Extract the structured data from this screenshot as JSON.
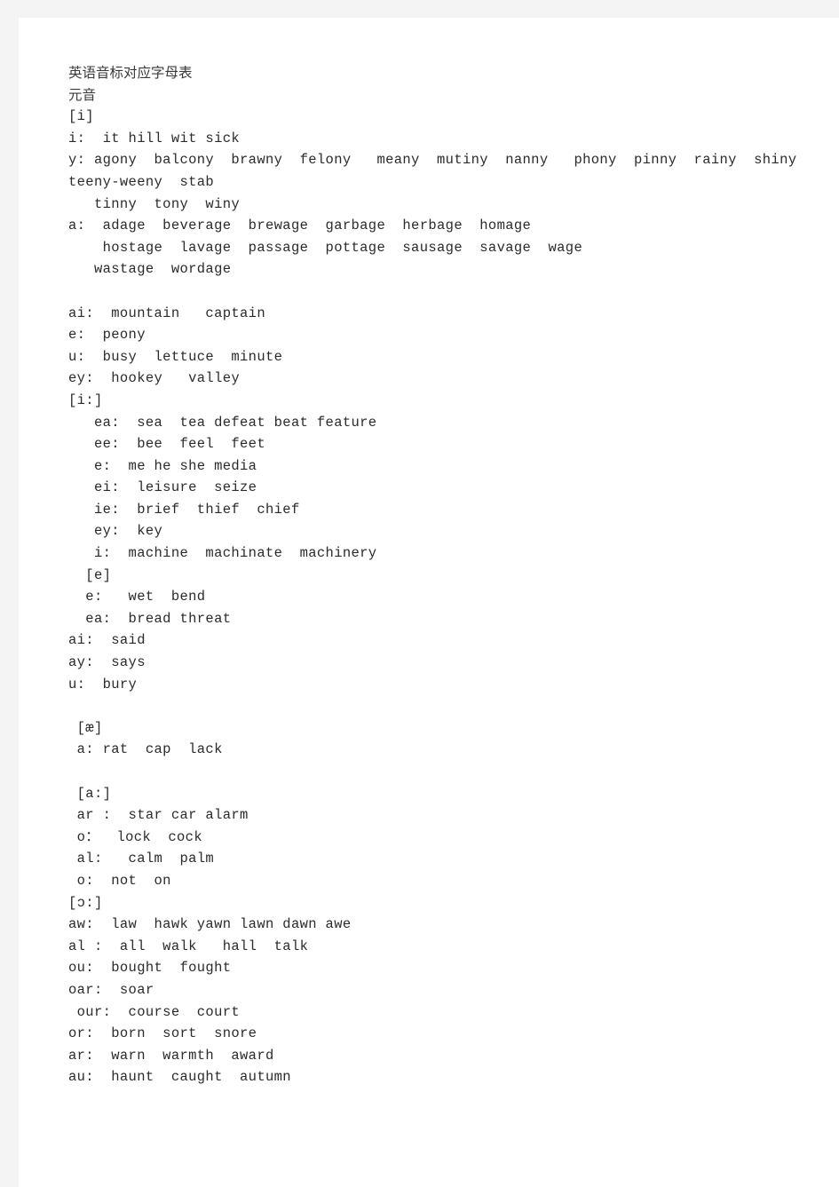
{
  "document": {
    "title_cn": "英语音标对应字母表",
    "section_heading_cn": "元音",
    "lines": [
      {
        "id": "title",
        "kind": "title",
        "text": "英语音标对应字母表"
      },
      {
        "id": "vowels-heading",
        "kind": "title",
        "text": "元音"
      },
      {
        "id": "sym-i",
        "kind": "symbol",
        "text": "[i]"
      },
      {
        "id": "i-i",
        "kind": "entry",
        "text": "i:  it hill wit sick"
      },
      {
        "id": "i-y-1",
        "kind": "entry",
        "text": "y: agony  balcony  brawny  felony   meany  mutiny  nanny   phony  pinny  rainy  shiny"
      },
      {
        "id": "i-y-2",
        "kind": "entry",
        "text": "teeny-weeny  stab"
      },
      {
        "id": "i-y-3",
        "kind": "entry",
        "text": "   tinny  tony  winy"
      },
      {
        "id": "i-a-1",
        "kind": "entry",
        "text": "a:  adage  beverage  brewage  garbage  herbage  homage"
      },
      {
        "id": "i-a-2",
        "kind": "entry",
        "text": "    hostage  lavage  passage  pottage  sausage  savage  wage"
      },
      {
        "id": "i-a-3",
        "kind": "entry",
        "text": "   wastage  wordage"
      },
      {
        "id": "blank-1",
        "kind": "blank",
        "text": " "
      },
      {
        "id": "i-ai",
        "kind": "entry",
        "text": "ai:  mountain   captain"
      },
      {
        "id": "i-e",
        "kind": "entry",
        "text": "e:  peony"
      },
      {
        "id": "i-u",
        "kind": "entry",
        "text": "u:  busy  lettuce  minute"
      },
      {
        "id": "i-ey",
        "kind": "entry",
        "text": "ey:  hookey   valley"
      },
      {
        "id": "sym-i-long",
        "kind": "symbol",
        "text": "[i:]"
      },
      {
        "id": "ilong-ea",
        "kind": "entry",
        "text": "   ea:  sea  tea defeat beat feature"
      },
      {
        "id": "ilong-ee",
        "kind": "entry",
        "text": "   ee:  bee  feel  feet"
      },
      {
        "id": "ilong-e",
        "kind": "entry",
        "text": "   e:  me he she media"
      },
      {
        "id": "ilong-ei",
        "kind": "entry",
        "text": "   ei:  leisure  seize"
      },
      {
        "id": "ilong-ie",
        "kind": "entry",
        "text": "   ie:  brief  thief  chief"
      },
      {
        "id": "ilong-ey",
        "kind": "entry",
        "text": "   ey:  key"
      },
      {
        "id": "ilong-i",
        "kind": "entry",
        "text": "   i:  machine  machinate  machinery"
      },
      {
        "id": "sym-e",
        "kind": "symbol",
        "text": "  [e]"
      },
      {
        "id": "e-e",
        "kind": "entry",
        "text": "  e:   wet  bend"
      },
      {
        "id": "e-ea",
        "kind": "entry",
        "text": "  ea:  bread threat"
      },
      {
        "id": "e-ai",
        "kind": "entry",
        "text": "ai:  said"
      },
      {
        "id": "e-ay",
        "kind": "entry",
        "text": "ay:  says"
      },
      {
        "id": "e-u",
        "kind": "entry",
        "text": "u:  bury"
      },
      {
        "id": "blank-2",
        "kind": "blank",
        "text": " "
      },
      {
        "id": "sym-ae",
        "kind": "symbol",
        "text": " [æ]"
      },
      {
        "id": "ae-a",
        "kind": "entry",
        "text": " a: rat  cap  lack"
      },
      {
        "id": "blank-3",
        "kind": "blank",
        "text": " "
      },
      {
        "id": "sym-a-long",
        "kind": "symbol",
        "text": " [a:]"
      },
      {
        "id": "along-ar",
        "kind": "entry",
        "text": " ar :  star car alarm"
      },
      {
        "id": "along-o-1",
        "kind": "entry",
        "text": " o：  lock  cock"
      },
      {
        "id": "along-al",
        "kind": "entry",
        "text": " al:   calm  palm"
      },
      {
        "id": "along-o-2",
        "kind": "entry",
        "text": " o:  not  on"
      },
      {
        "id": "sym-open-o-long",
        "kind": "symbol",
        "text": "[ɔ:]"
      },
      {
        "id": "oo-aw",
        "kind": "entry",
        "text": "aw:  law  hawk yawn lawn dawn awe"
      },
      {
        "id": "oo-al",
        "kind": "entry",
        "text": "al :  all  walk   hall  talk"
      },
      {
        "id": "oo-ou",
        "kind": "entry",
        "text": "ou:  bought  fought"
      },
      {
        "id": "oo-oar",
        "kind": "entry",
        "text": "oar:  soar"
      },
      {
        "id": "oo-our",
        "kind": "entry",
        "text": " our:  course  court"
      },
      {
        "id": "oo-or",
        "kind": "entry",
        "text": "or:  born  sort  snore"
      },
      {
        "id": "oo-ar",
        "kind": "entry",
        "text": "ar:  warn  warmth  award"
      },
      {
        "id": "oo-au",
        "kind": "entry",
        "text": "au:  haunt  caught  autumn"
      }
    ]
  },
  "colors": {
    "page_background": "#ffffff",
    "margin_band": "#f4f4f4",
    "text": "#2b2b2b",
    "title_text": "#3a3a3a"
  }
}
